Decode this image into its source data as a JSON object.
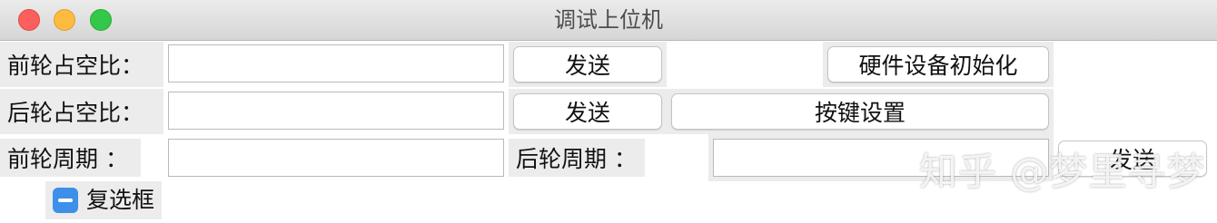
{
  "window": {
    "title": "调试上位机"
  },
  "row1": {
    "label": "前轮占空比：",
    "input_value": "",
    "send_label": "发送",
    "init_label": "硬件设备初始化"
  },
  "row2": {
    "label": "后轮占空比：",
    "input_value": "",
    "send_label": "发送",
    "key_settings_label": "按键设置"
  },
  "row3": {
    "front_period_label": "前轮周期 ：",
    "front_period_value": "",
    "rear_period_label": "后轮周期 ：",
    "rear_period_value": "",
    "send_label": "发送"
  },
  "checkbox": {
    "label": "复选框",
    "state": "indeterminate"
  },
  "watermark": "知乎 @梦里寻梦"
}
